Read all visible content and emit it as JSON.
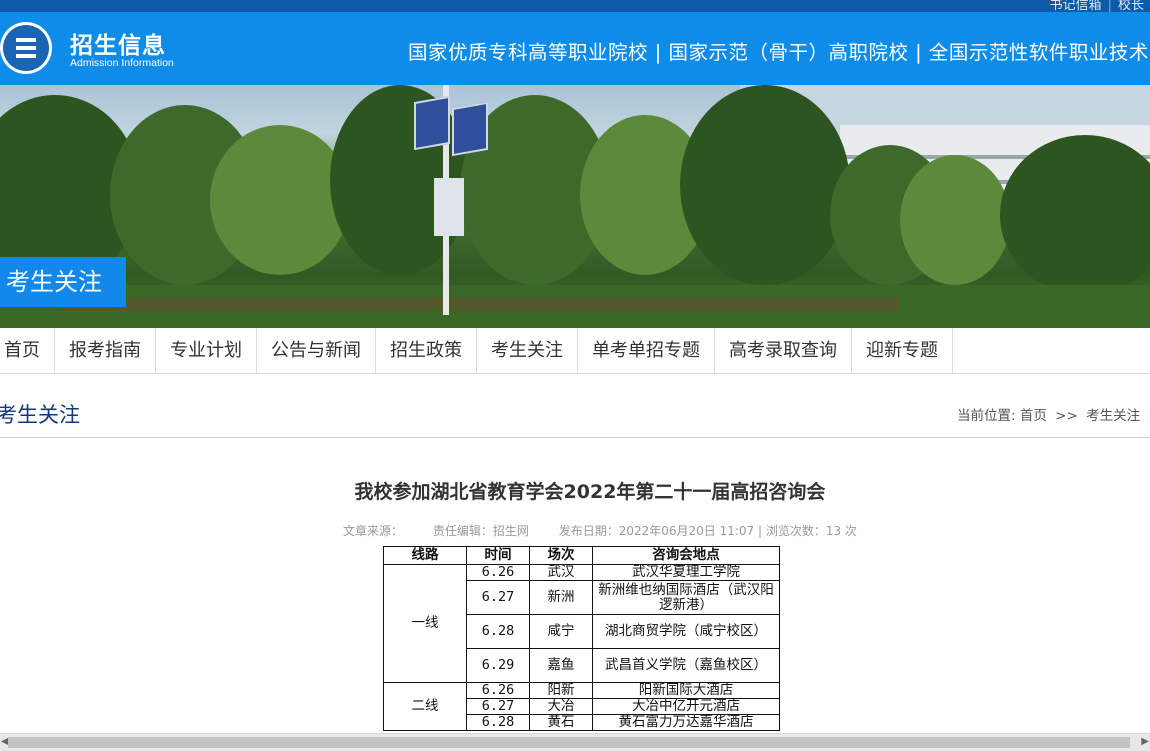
{
  "top_links": [
    "书记信箱",
    "校长"
  ],
  "header": {
    "brand_cn": "招生信息",
    "brand_en": "Admission Information",
    "slogan": "国家优质专科高等职业院校 | 国家示范（骨干）高职院校 | 全国示范性软件职业技术学"
  },
  "banner": {
    "tag": "考生关注"
  },
  "nav": [
    "首页",
    "报考指南",
    "专业计划",
    "公告与新闻",
    "招生政策",
    "考生关注",
    "单考单招专题",
    "高考录取查询",
    "迎新专题"
  ],
  "section": {
    "title": "考生关注"
  },
  "breadcrumb": {
    "label": "当前位置:",
    "home": "首页",
    "sep": ">>",
    "current": "考生关注",
    "tail": ">"
  },
  "article": {
    "title": "我校参加湖北省教育学会2022年第二十一届高招咨询会",
    "source": "文章来源：",
    "editor": "责任编辑：招生网",
    "date": "发布日期：2022年06月20日 11:07 | 浏览次数：13 次"
  },
  "table": {
    "headers": [
      "线路",
      "时间",
      "场次",
      "咨询会地点"
    ],
    "groups": [
      {
        "route": "一线",
        "rows": [
          {
            "date": "6.26",
            "city": "武汉",
            "venue": "武汉华夏理工学院"
          },
          {
            "date": "6.27",
            "city": "新洲",
            "venue": "新洲维也纳国际酒店（武汉阳逻新港）"
          },
          {
            "date": "6.28",
            "city": "咸宁",
            "venue": "湖北商贸学院（咸宁校区）"
          },
          {
            "date": "6.29",
            "city": "嘉鱼",
            "venue": "武昌首义学院（嘉鱼校区）"
          }
        ]
      },
      {
        "route": "二线",
        "rows": [
          {
            "date": "6.26",
            "city": "阳新",
            "venue": "阳新国际大酒店"
          },
          {
            "date": "6.27",
            "city": "大冶",
            "venue": "大冶中亿开元酒店"
          },
          {
            "date": "6.28",
            "city": "黄石",
            "venue": "黄石富力万达嘉华酒店"
          }
        ]
      }
    ]
  },
  "colors": {
    "header_blue": "#0f8be8",
    "top_strip": "#0c5aa8",
    "tag_blue": "#1288ea",
    "section_title": "#123a7a"
  }
}
